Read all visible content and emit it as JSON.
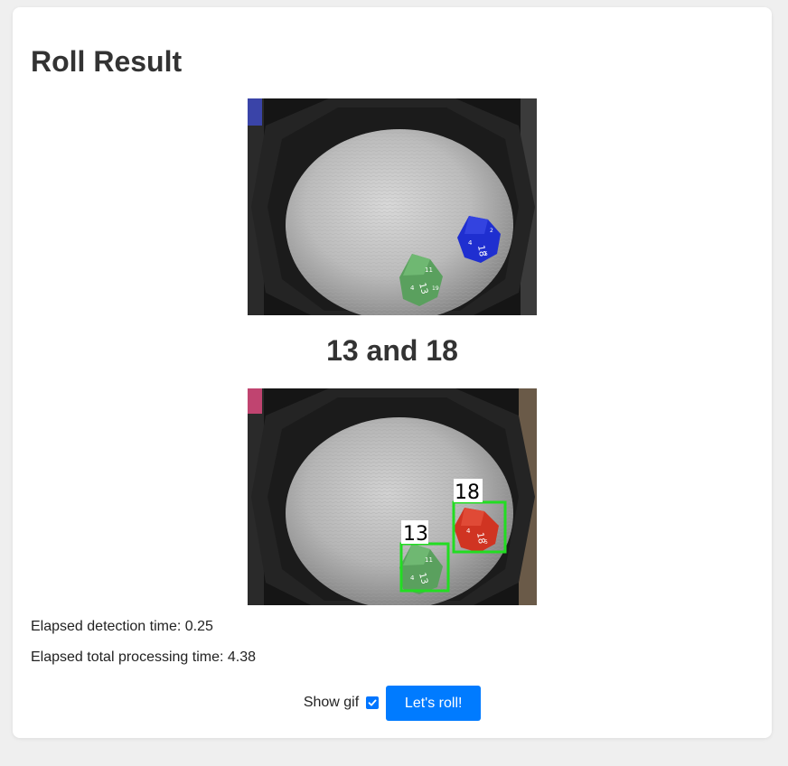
{
  "page": {
    "title": "Roll Result",
    "result_text": "13 and 18",
    "photo_raw_name": "raw-dice-photo",
    "photo_annotated_name": "annotated-dice-photo"
  },
  "detections": {
    "labels": [
      "13",
      "18"
    ],
    "box_color": "#22dd22"
  },
  "dice": {
    "green_faces": [
      "13",
      "4",
      "11",
      "19"
    ],
    "blue_faces": [
      "18",
      "4",
      "5",
      "2"
    ],
    "red_faces": [
      "18",
      "4",
      "5",
      "2"
    ],
    "green_color": "#5aa05e",
    "blue_color": "#1f2fd0",
    "red_color": "#d03422"
  },
  "stats": {
    "detection_label": "Elapsed detection time: 0.25",
    "total_label": "Elapsed total processing time: 4.38"
  },
  "controls": {
    "show_gif_label": "Show gif",
    "show_gif_checked": true,
    "roll_button_label": "Let's roll!",
    "accent_color": "#007bff"
  }
}
